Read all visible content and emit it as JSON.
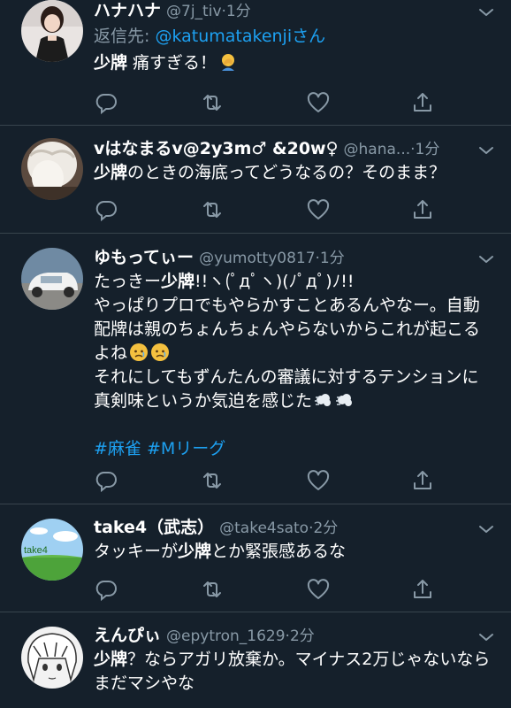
{
  "tweets": [
    {
      "name": "ハナハナ",
      "handle": "@7j_tiv",
      "dot": "·",
      "time": "1分",
      "reply_prefix": "返信先: ",
      "reply_handle": "@katumatakenji",
      "reply_suffix": "さん",
      "text_bold": "少牌",
      "text": " 痛すぎる！",
      "emoji": "face-palm-emoji"
    },
    {
      "name": "vはなまるv@2y3m♂ &20w♀",
      "handle": "@hana...",
      "dot": "·",
      "time": "1分",
      "text_bold": "少牌",
      "text": "のときの海底ってどうなるの？そのまま？"
    },
    {
      "name": "ゆもってぃー",
      "handle": "@yumotty0817",
      "dot": "·",
      "time": "1分",
      "line1_pre": "たっきー",
      "line1_bold": "少牌",
      "line1_post": "!!ヽ(ﾟдﾟヽ)(ﾉﾟдﾟ)ﾉ!!",
      "line2": "やっぱりプロでもやらかすことあるんやなー。自動",
      "line3": "配牌は親のちょんちょんやらないからこれが起こる",
      "line4": "よね",
      "line5": "それにしてもずんたんの審議に対するテンションに",
      "line6": "真剣味というか気迫を感じた",
      "hashtag1": "#麻雀",
      "hashtag2": "#Mリーグ",
      "emoji_sad": "sad-face-emoji",
      "emoji_dash": "dash-emoji"
    },
    {
      "name": "take4（武志）",
      "handle": "@take4sato",
      "dot": "·",
      "time": "2分",
      "text_pre": "タッキーが",
      "text_bold": "少牌",
      "text_post": "とか緊張感あるな",
      "avatar_label": "take4"
    },
    {
      "name": "えんぴぃ",
      "handle": "@epytron_1629",
      "dot": "·",
      "time": "2分",
      "text_bold": "少牌",
      "text_line1": "？ならアガリ放棄か。マイナス2万じゃないなら",
      "text_line2": "まだマシやな"
    }
  ],
  "icons": {
    "reply": "reply-icon",
    "retweet": "retweet-icon",
    "like": "heart-icon",
    "share": "share-icon",
    "caret": "chevron-down-icon"
  },
  "colors": {
    "background": "#15202b",
    "secondary_text": "#8899a6",
    "link": "#1da1f2",
    "divider": "#38444d"
  }
}
